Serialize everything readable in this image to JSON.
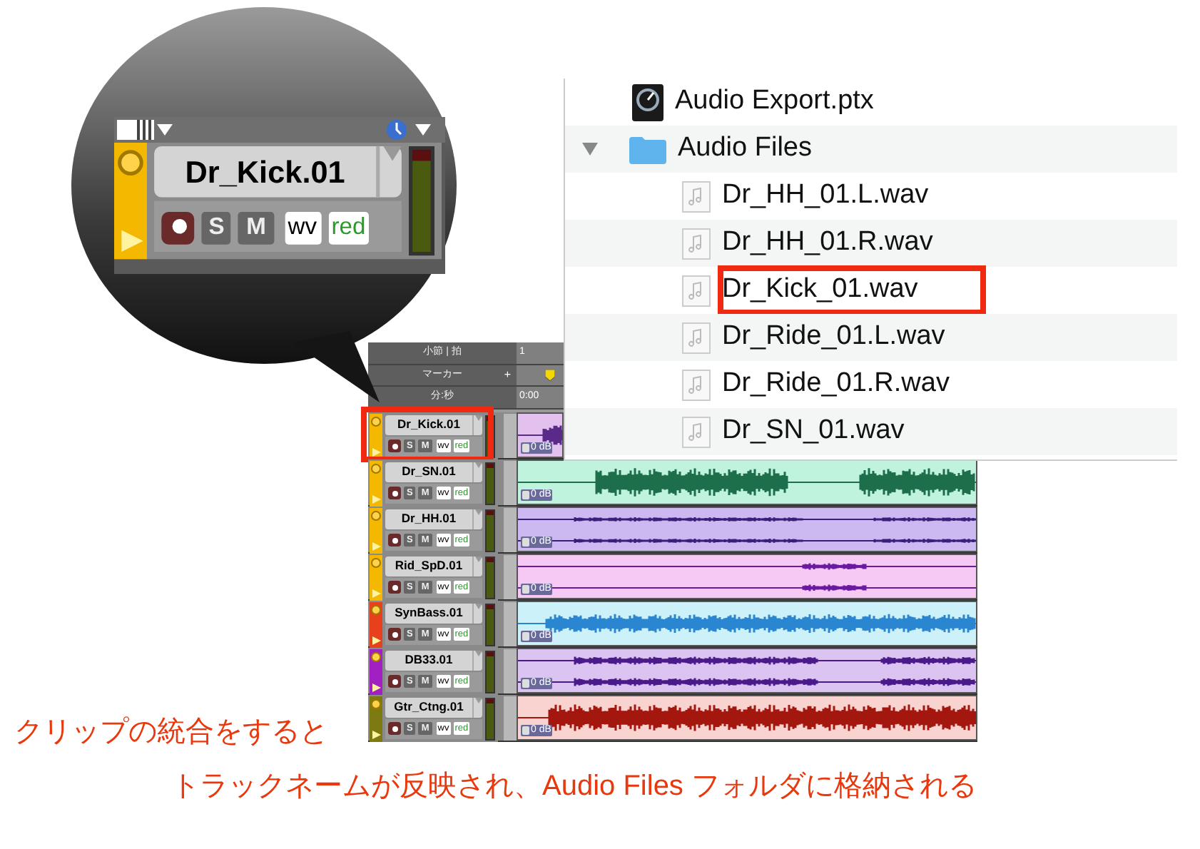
{
  "zoom_view": {
    "track": {
      "name": "Dr_Kick.01",
      "color": "#f5b800",
      "buttons": [
        "S",
        "M",
        "wv",
        "red"
      ]
    }
  },
  "browser": {
    "items": [
      {
        "kind": "session",
        "name": "Audio Export.ptx"
      },
      {
        "kind": "folder",
        "name": "Audio Files",
        "expanded": true,
        "children": [
          {
            "kind": "audio",
            "name": "Dr_HH_01.L.wav",
            "highlighted": false
          },
          {
            "kind": "audio",
            "name": "Dr_HH_01.R.wav",
            "highlighted": false
          },
          {
            "kind": "audio",
            "name": "Dr_Kick_01.wav",
            "highlighted": true
          },
          {
            "kind": "audio",
            "name": "Dr_Ride_01.L.wav",
            "highlighted": false
          },
          {
            "kind": "audio",
            "name": "Dr_Ride_01.R.wav",
            "highlighted": false
          },
          {
            "kind": "audio",
            "name": "Dr_SN_01.wav",
            "highlighted": false
          }
        ]
      }
    ]
  },
  "ruler": {
    "rows": [
      {
        "label": "小節 | 拍",
        "value": "1"
      },
      {
        "label": "マーカー",
        "add": "+",
        "value": ""
      },
      {
        "label": "分:秒",
        "value": "0:00"
      }
    ]
  },
  "tracks": [
    {
      "name": "Dr_Kick.01",
      "color": "#f5b800",
      "kind": "mono",
      "clip": {
        "color": "#e3c1ef",
        "gain": "0 dB"
      },
      "waveform": {
        "color": "#5a2a8a"
      },
      "buttons": [
        "S",
        "M",
        "wv",
        "red"
      ],
      "highlighted": true
    },
    {
      "name": "Dr_SN.01",
      "color": "#f5b800",
      "kind": "mono",
      "clip": {
        "color": "#bff3dd",
        "gain": "0 dB"
      },
      "waveform": {
        "color": "#1d6e4a"
      },
      "buttons": [
        "S",
        "M",
        "wv",
        "red"
      ],
      "highlighted": false
    },
    {
      "name": "Dr_HH.01",
      "color": "#f5b800",
      "kind": "stereo",
      "clip": {
        "color": "#cdb9f2",
        "gain": "0 dB"
      },
      "waveform": {
        "color": "#3b1d7a"
      },
      "buttons": [
        "S",
        "M",
        "wv",
        "red"
      ],
      "highlighted": false
    },
    {
      "name": "Rid_SpD.01",
      "color": "#f5b800",
      "kind": "stereo",
      "clip": {
        "color": "#f5c9f3",
        "gain": "0 dB"
      },
      "waveform": {
        "color": "#6a1aa0"
      },
      "buttons": [
        "S",
        "M",
        "wv",
        "red"
      ],
      "highlighted": false
    },
    {
      "name": "SynBass.01",
      "color": "#e8401c",
      "kind": "mono",
      "clip": {
        "color": "#cdf1f8",
        "gain": "0 dB"
      },
      "waveform": {
        "color": "#2a86d0"
      },
      "buttons": [
        "S",
        "M",
        "wv",
        "red"
      ],
      "highlighted": false
    },
    {
      "name": "DB33.01",
      "color": "#a21fc4",
      "kind": "stereo",
      "clip": {
        "color": "#dcc4f2",
        "gain": "0 dB"
      },
      "waveform": {
        "color": "#4a1a8a"
      },
      "buttons": [
        "S",
        "M",
        "wv",
        "red"
      ],
      "highlighted": false
    },
    {
      "name": "Gtr_Ctng.01",
      "color": "#7d7a12",
      "kind": "mono",
      "clip": {
        "color": "#f8d3cf",
        "gain": "0 dB"
      },
      "waveform": {
        "color": "#a3170f"
      },
      "buttons": [
        "S",
        "M",
        "wv",
        "red"
      ],
      "highlighted": false
    }
  ],
  "captions": [
    "クリップの統合をすると",
    "トラックネームが反映され、Audio Files フォルダに格納される"
  ]
}
